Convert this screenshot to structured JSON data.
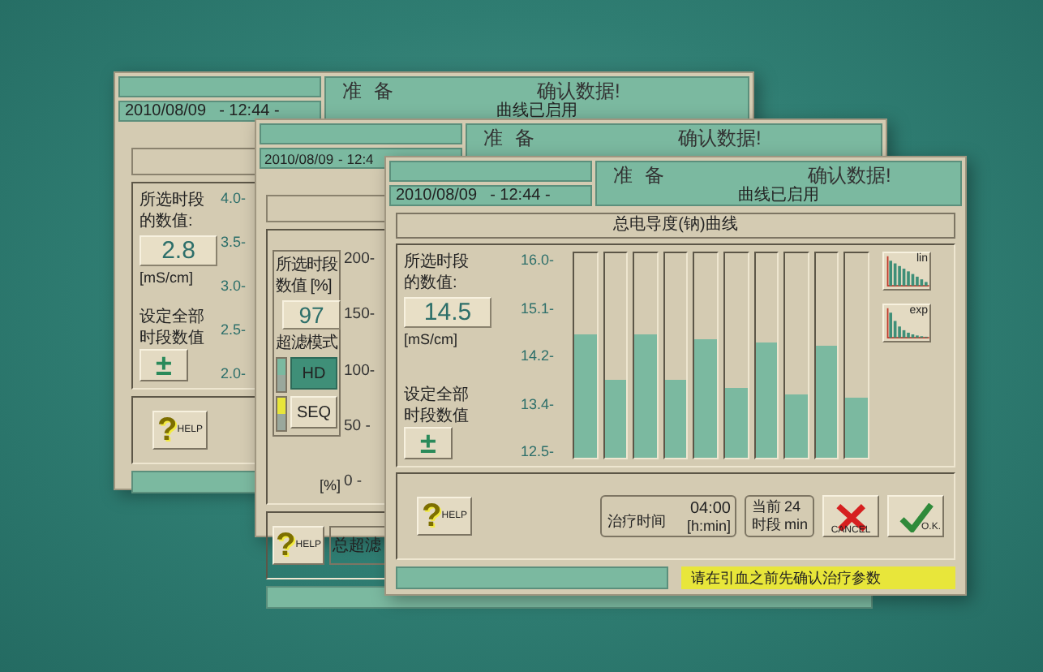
{
  "background_window": {
    "header": {
      "status": "准 备",
      "message": "确认数据!",
      "subtitle": "曲线已启用",
      "date": "2010/08/09",
      "time": "- 12:44 -"
    },
    "value_label": [
      "所选时段",
      "的数值:"
    ],
    "value": "2.8",
    "unit": "[mS/cm]",
    "set_all_label": [
      "设定全部",
      "时段数值"
    ],
    "set_all_button": "±",
    "axis_labels": [
      "4.0-",
      "3.5-",
      "3.0-",
      "2.5-",
      "2.0-"
    ],
    "help": {
      "glyph": "?",
      "label": "HELP"
    }
  },
  "middle_window": {
    "header": {
      "status": "准 备",
      "message": "确认数据!",
      "date": "2010/08/09",
      "time": "- 12:4"
    },
    "value_label": [
      "所选时段",
      "数值 [%]"
    ],
    "value": "97",
    "mode_label": "超滤模式",
    "modes": [
      {
        "label": "HD",
        "selected": true,
        "color": "#7bb9a0"
      },
      {
        "label": "SEQ",
        "selected": false,
        "color": "#e8e63a"
      }
    ],
    "axis_labels": [
      "200-",
      "150-",
      "100-",
      "50 -",
      "0 -"
    ],
    "axis_unit": "[%]",
    "help": {
      "glyph": "?",
      "label": "HELP"
    },
    "total_label": "总超滤"
  },
  "front_window": {
    "header": {
      "status": "准 备",
      "message": "确认数据!",
      "subtitle": "曲线已启用",
      "date": "2010/08/09",
      "time": "- 12:44 -"
    },
    "chart_title": "总电导度(钠)曲线",
    "value_label": [
      "所选时段",
      "的数值:"
    ],
    "value": "14.5",
    "unit": "[mS/cm]",
    "set_all_label": [
      "设定全部",
      "时段数值"
    ],
    "set_all_button": "±",
    "axis_labels": [
      "16.0-",
      "15.1-",
      "14.2-",
      "13.4-",
      "12.5-"
    ],
    "segments": [
      {
        "level": 0.6
      },
      {
        "level": 0.38
      },
      {
        "level": 0.6
      },
      {
        "level": 0.38
      },
      {
        "level": 0.58
      },
      {
        "level": 0.34
      },
      {
        "level": 0.56
      },
      {
        "level": 0.31
      },
      {
        "level": 0.55
      },
      {
        "level": 0.29
      }
    ],
    "curve_buttons": [
      {
        "kind": "lin",
        "label": "lin"
      },
      {
        "kind": "exp",
        "label": "exp"
      }
    ],
    "help": {
      "glyph": "?",
      "label": "HELP"
    },
    "treatment_time": {
      "label": "治疗时间",
      "value": "04:00",
      "unit": "[h:min]"
    },
    "current_segment": {
      "label_top": "当前",
      "label_bottom": "时段",
      "value": "24",
      "unit": "min"
    },
    "cancel_button": "CANCEL",
    "ok_button": "O.K.",
    "status_message": "请在引血之前先确认治疗参数"
  }
}
